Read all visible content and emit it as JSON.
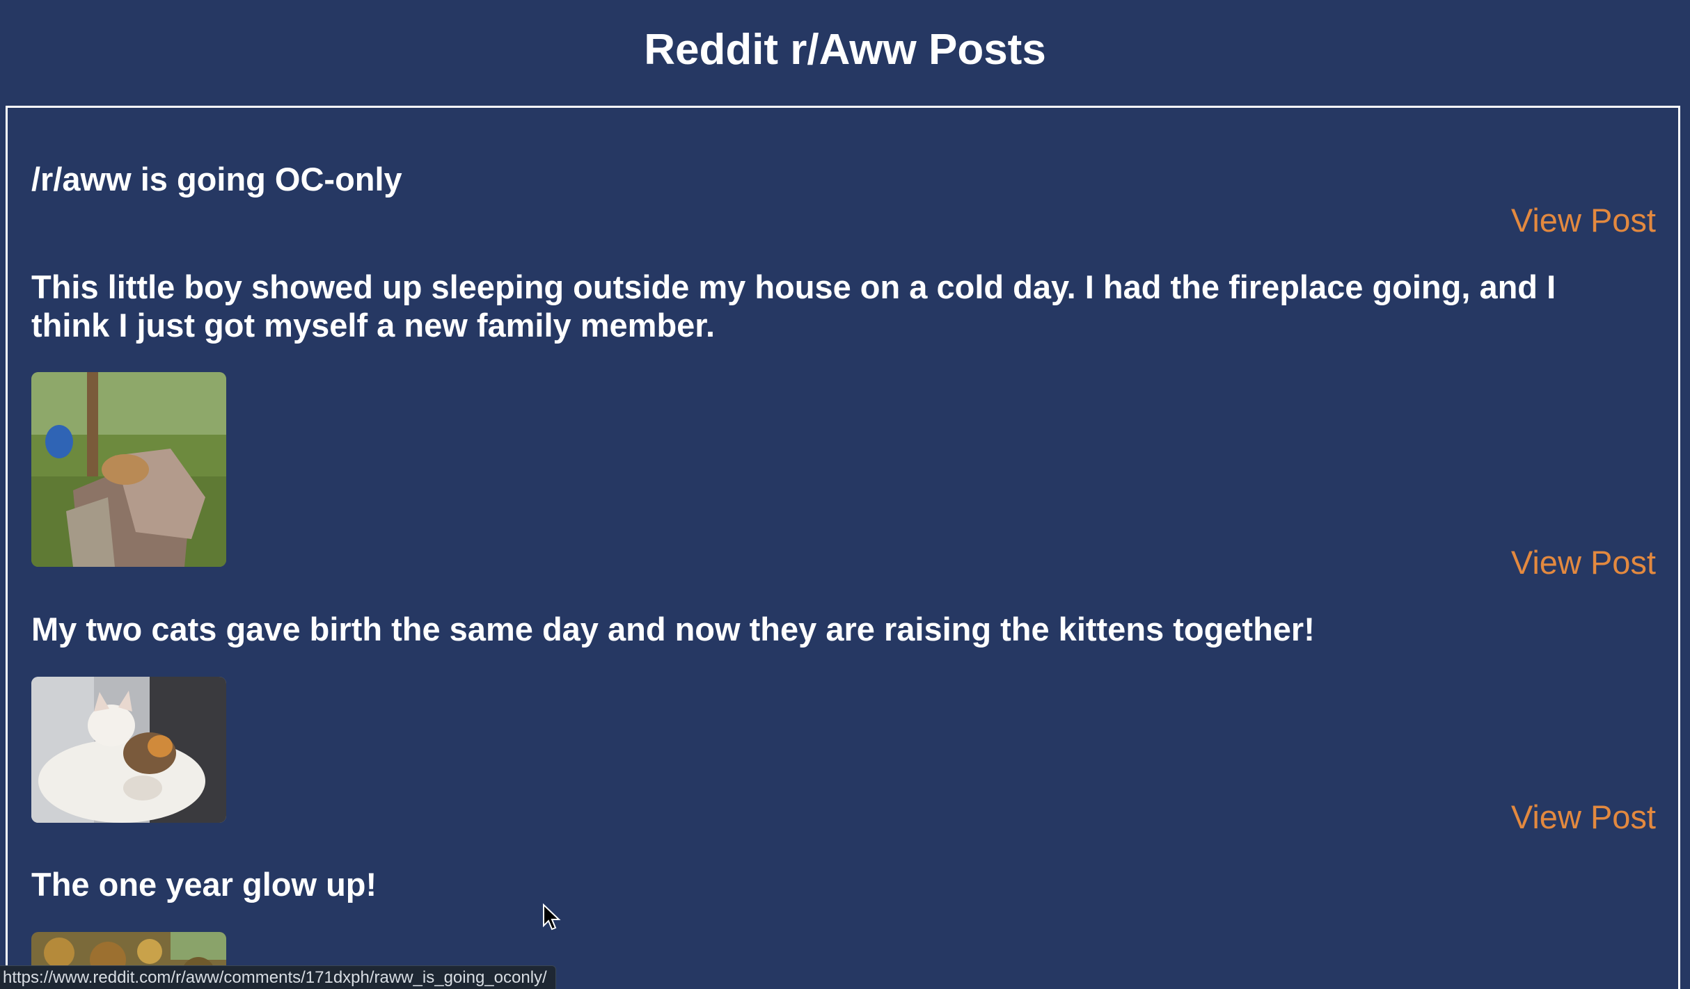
{
  "header": {
    "title": "Reddit r/Aww Posts"
  },
  "posts": [
    {
      "title": "/r/aww is going OC-only",
      "link_label": "View Post",
      "has_image": false
    },
    {
      "title": "This little boy showed up sleeping outside my house on a cold day. I had the fireplace going, and I think I just got myself a new family member.",
      "link_label": "View Post",
      "has_image": true,
      "image_subject": "cat sleeping on a blanket pile outdoors"
    },
    {
      "title": "My two cats gave birth the same day and now they are raising the kittens together!",
      "link_label": "View Post",
      "has_image": true,
      "image_subject": "two cats cuddling with kittens"
    },
    {
      "title": "The one year glow up!",
      "has_image": true,
      "image_subject": "autumn leaves photo"
    }
  ],
  "status_bar": {
    "url": "https://www.reddit.com/r/aww/comments/171dxph/raww_is_going_oconly/"
  },
  "colors": {
    "background": "#263863",
    "link": "#e3893f",
    "text": "#ffffff"
  }
}
